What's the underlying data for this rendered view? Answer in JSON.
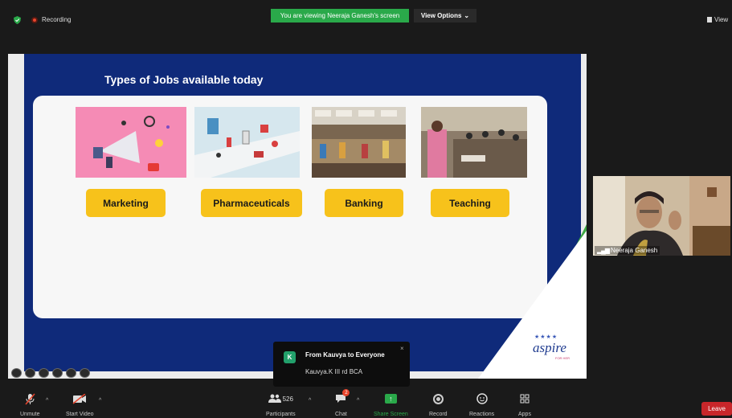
{
  "top_bar": {
    "recording_label": "Recording",
    "viewing_banner": "You are viewing Neeraja Ganesh's screen",
    "view_options_label": "View Options",
    "view_label": "View"
  },
  "slide": {
    "title": "Types of Jobs available today",
    "jobs": [
      {
        "label": "Marketing"
      },
      {
        "label": "Pharmaceuticals"
      },
      {
        "label": "Banking"
      },
      {
        "label": "Teaching"
      }
    ],
    "logo_text": "aspire",
    "logo_subtext": "FOR HER"
  },
  "participant_video": {
    "name": "Neeraja Ganesh"
  },
  "chat_popup": {
    "avatar_initial": "K",
    "from": "From Kauvya to Everyone",
    "message": "Kauvya.K III rd BCA",
    "close_glyph": "×"
  },
  "toolbar": {
    "unmute_label": "Unmute",
    "start_video_label": "Start Video",
    "participants_label": "Participants",
    "participants_count": "526",
    "chat_label": "Chat",
    "chat_badge": "2",
    "share_screen_label": "Share Screen",
    "record_label": "Record",
    "reactions_label": "Reactions",
    "apps_label": "Apps",
    "leave_label": "Leave"
  },
  "colors": {
    "slide_blue": "#0f2a7a",
    "button_yellow": "#f7c21b",
    "zoom_green": "#2aa94a",
    "leave_red": "#c8262a"
  }
}
